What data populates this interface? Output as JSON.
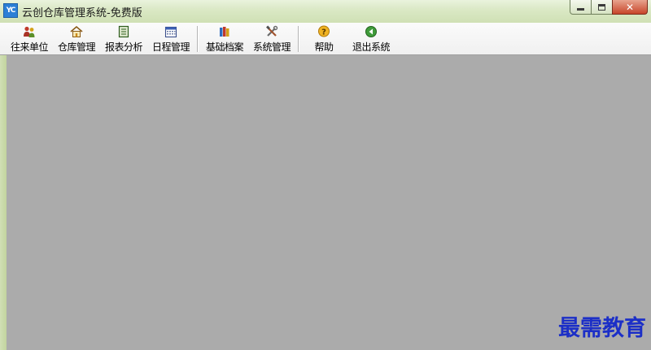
{
  "window": {
    "app_icon_text": "YC",
    "title": "云创仓库管理系统-免费版",
    "close_glyph": "✕"
  },
  "toolbar": {
    "items": [
      {
        "label": "往来单位",
        "icon": "contacts-icon"
      },
      {
        "label": "仓库管理",
        "icon": "warehouse-icon"
      },
      {
        "label": "报表分析",
        "icon": "report-icon"
      },
      {
        "label": "日程管理",
        "icon": "calendar-icon"
      },
      {
        "label": "基础档案",
        "icon": "archive-icon"
      },
      {
        "label": "系统管理",
        "icon": "tools-icon"
      },
      {
        "label": "帮助",
        "icon": "help-icon"
      },
      {
        "label": "退出系统",
        "icon": "exit-icon"
      }
    ]
  },
  "watermark": {
    "text": "最需教育"
  },
  "colors": {
    "client_background": "#ababab",
    "titlebar": "#d9e6bf",
    "toolbar": "#f5f5f5",
    "watermark": "#1c2fc7"
  }
}
